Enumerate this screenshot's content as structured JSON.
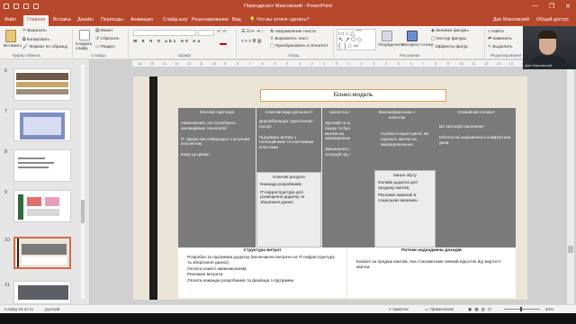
{
  "window": {
    "title": "Переодизаст Максовский - PowerPoint",
    "controls": [
      "—",
      "❐",
      "✕"
    ]
  },
  "tabs": [
    "Файл",
    "Главная",
    "Вставка",
    "Дизайн",
    "Переходы",
    "Анимация",
    "Слайд-шоу",
    "Рецензирование",
    "Вид"
  ],
  "active_tab": "Главная",
  "tell_me": "Что вы хотите сделать?",
  "user_label": "Дан Максовский",
  "share_label": "Общий доступ",
  "ribbon": {
    "clipboard": {
      "paste": "Вставить",
      "cut": "Вырезать",
      "copy": "Копировать",
      "format_painter": "Формат по образцу",
      "group": "Буфер обмена"
    },
    "slides": {
      "new_slide": "Создать слайд",
      "layout": "Макет",
      "reset": "Сбросить",
      "section": "Раздел",
      "group": "Слайды"
    },
    "font_group": "Шрифт",
    "paragraph_group": "Абзац",
    "paragraph": {
      "text_direction": "Направление текста",
      "align_text": "Выровнять текст",
      "convert_smartart": "Преобразовать в SmartArt"
    },
    "drawing": {
      "arrange": "Упорядочить",
      "quick_styles": "Экспресс-стили",
      "fill": "Заливка фигуры",
      "outline": "Контур фигуры",
      "effects": "Эффекты фигур",
      "group": "Рисование"
    },
    "editing": {
      "find": "Найти",
      "replace": "Заменить",
      "select": "Выделить",
      "group": "Редактирование"
    }
  },
  "ruler_marks": [
    "16",
    "15",
    "14",
    "13",
    "12",
    "11",
    "10",
    "9",
    "8",
    "7",
    "6",
    "5",
    "4",
    "3",
    "2",
    "1",
    "0",
    "1",
    "2",
    "3",
    "4",
    "5",
    "6",
    "7",
    "8",
    "9",
    "10",
    "11",
    "12",
    "13",
    "14",
    "15",
    "16"
  ],
  "thumbnails": [
    {
      "num": "6",
      "active": false
    },
    {
      "num": "7",
      "active": false
    },
    {
      "num": "8",
      "active": false
    },
    {
      "num": "9",
      "active": false
    },
    {
      "num": "10",
      "active": true
    },
    {
      "num": "11",
      "active": false
    }
  ],
  "slide": {
    "title": "Бізнес-модель",
    "columns": [
      {
        "header": "Ключові партнери",
        "items": [
          "Авіакомпанії, які потребують інноваційних технологій",
          "ІТ сфера яка співпрацює з штучним інтелектом",
          "Кому це цікаво"
        ]
      },
      {
        "header": "Ключові види діяльності",
        "items": [
          "Дорожбалацця туристичних послуг",
          "Підтримка зв'язку з потенційними та ключовими клієнтами"
        ]
      },
      {
        "header": "Цінністна пропозиція",
        "items": [
          "Зручний та швидкий пошук та бронювання квитків на авіаперевезення.",
          "Зменшення стресових ситуацій під час подорожі"
        ]
      },
      {
        "header": "Взаємовідносини з клієнтом",
        "items": [
          "Особисті користувачі, які шукають квитки на авіаперевезення"
        ]
      },
      {
        "header": "Споживчий сегмент",
        "items": [
          "Всі категорії населення",
          "Клієнти які зацікавлені в комфортних умов"
        ]
      }
    ],
    "key_resources": {
      "header": "Ключові ресурси",
      "items": [
        "Команда розробників;",
        "IT-інфраструктура для розміщення додатку та зберігання даних;"
      ]
    },
    "channels": {
      "header": "Канал збуту",
      "items": [
        "Онлайн додаток для продажу квитків;",
        "Рекламні кампанії в соціальних мережах ."
      ]
    },
    "cost_structure": {
      "header": "Структура витрат",
      "lines": [
        "Розробка та підтримка додатку (включаючи витрати на IT-інфраструктуру та зберігання даних);",
        "Оплата комісії авіакомпаніям;",
        "Рекламні витрати;",
        "Оплата команди розробників та фахівців з підтримки."
      ]
    },
    "revenue_streams": {
      "header": "Потоки надходжень доходів",
      "lines": [
        "Комісія за продаж квитків, яка становитиме певний відсоток від вартості квитка."
      ]
    }
  },
  "status": {
    "slide_counter": "Слайд 10 из 11",
    "language": "русский",
    "notes": "Заметки",
    "comments": "Примечания",
    "zoom": "84%"
  },
  "colors": {
    "accent": "#b7472a",
    "column_gray": "#7a7a7a",
    "slide_bg": "#ebe5d8",
    "title_border": "#e0a050"
  }
}
